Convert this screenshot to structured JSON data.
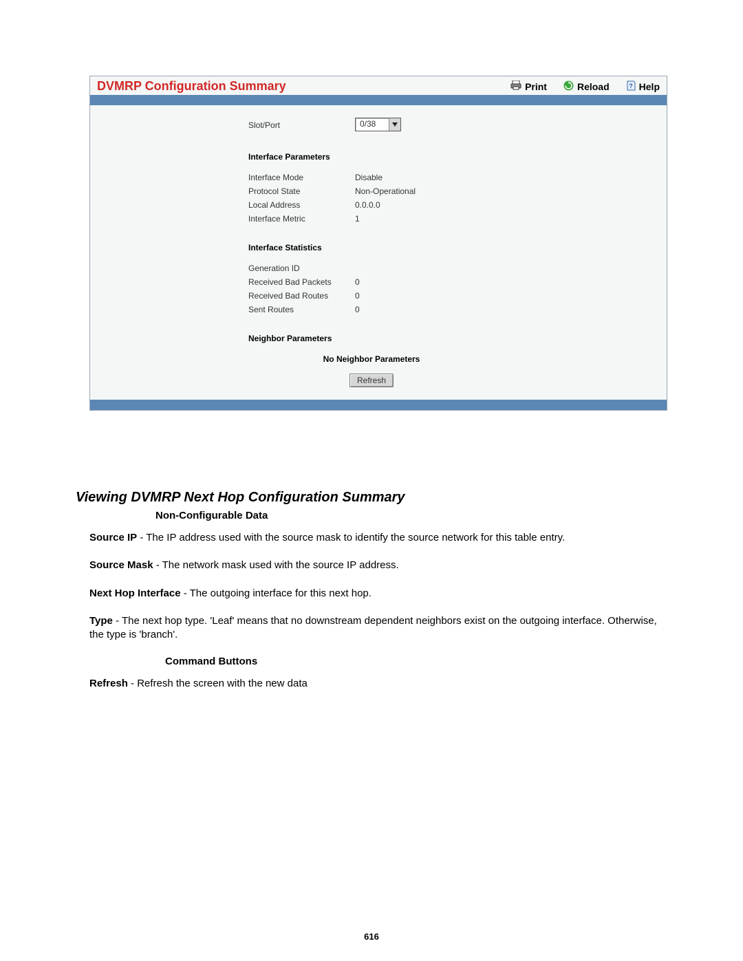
{
  "panel": {
    "title": "DVMRP Configuration Summary",
    "actions": {
      "print": "Print",
      "reload": "Reload",
      "help": "Help"
    },
    "slotport": {
      "label": "Slot/Port",
      "value": "0/38"
    },
    "sections": {
      "params_title": "Interface Parameters",
      "stats_title": "Interface Statistics",
      "neighbor_title": "Neighbor Parameters"
    },
    "params": {
      "mode_label": "Interface Mode",
      "mode_value": "Disable",
      "protocol_label": "Protocol State",
      "protocol_value": "Non-Operational",
      "local_label": "Local Address",
      "local_value": "0.0.0.0",
      "metric_label": "Interface Metric",
      "metric_value": "1"
    },
    "stats": {
      "gen_label": "Generation ID",
      "gen_value": "",
      "badpkts_label": "Received Bad Packets",
      "badpkts_value": "0",
      "badroutes_label": "Received Bad Routes",
      "badroutes_value": "0",
      "sent_label": "Sent Routes",
      "sent_value": "0"
    },
    "neighbor_empty": "No Neighbor Parameters",
    "refresh_label": "Refresh"
  },
  "doc": {
    "heading": "Viewing DVMRP Next Hop Configuration Summary",
    "sub1": "Non-Configurable Data",
    "p1_bold": "Source IP",
    "p1_rest": " - The IP address used with the source mask to identify the source network for this table entry.",
    "p2_bold": "Source Mask",
    "p2_rest": " - The network mask used with the source IP address.",
    "p3_bold": "Next Hop Interface",
    "p3_rest": " - The outgoing interface for this next hop.",
    "p4_bold": "Type",
    "p4_rest": " - The next hop type. 'Leaf' means that no downstream dependent neighbors exist on the outgoing interface. Otherwise, the type is 'branch'.",
    "sub2": "Command Buttons",
    "p5_bold": "Refresh",
    "p5_rest": " - Refresh the screen with the new data"
  },
  "page_number": "616"
}
